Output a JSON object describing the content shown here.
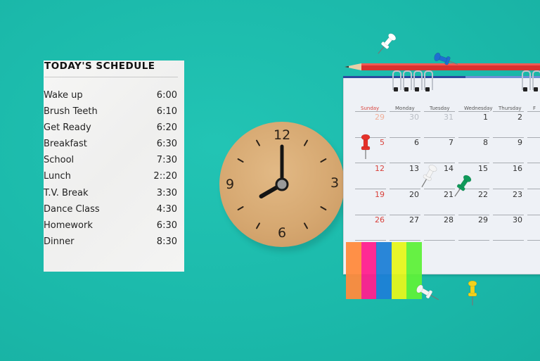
{
  "background_color": "#1dbdae",
  "schedule": {
    "title": "TODAY'S SCHEDULE",
    "items": [
      {
        "activity": "Wake up",
        "time": "6:00"
      },
      {
        "activity": "Brush Teeth",
        "time": "6:10"
      },
      {
        "activity": "Get Ready",
        "time": "6:20"
      },
      {
        "activity": "Breakfast",
        "time": "6:30"
      },
      {
        "activity": "School",
        "time": "7:30"
      },
      {
        "activity": "Lunch",
        "time": "2::20"
      },
      {
        "activity": "T.V. Break",
        "time": "3:30"
      },
      {
        "activity": "Dance Class",
        "time": "4:30"
      },
      {
        "activity": "Homework",
        "time": "6:30"
      },
      {
        "activity": "Dinner",
        "time": "8:30"
      }
    ]
  },
  "clock": {
    "numerals": {
      "twelve": "12",
      "three": "3",
      "six": "6",
      "nine": "9"
    },
    "time_shown": "8:00"
  },
  "calendar": {
    "day_names": [
      "Sunday",
      "Monday",
      "Tuesday",
      "Wednesday",
      "Thursday",
      "F"
    ],
    "weeks": [
      [
        "29",
        "30",
        "31",
        "1",
        "2"
      ],
      [
        "5",
        "6",
        "7",
        "8",
        "9"
      ],
      [
        "12",
        "13",
        "14",
        "15",
        "16"
      ],
      [
        "19",
        "20",
        "21",
        "22",
        "23"
      ],
      [
        "26",
        "27",
        "28",
        "29",
        "30"
      ]
    ],
    "sunday_color": "#d9423c"
  },
  "sticky_flags": [
    "#ff8a3d",
    "#ff1f8e",
    "#1e7fd6",
    "#e6f51c",
    "#5ef03a"
  ],
  "pins": [
    {
      "name": "white-pin-top",
      "color": "#ffffff"
    },
    {
      "name": "blue-pin-top",
      "color": "#1e6fd0"
    },
    {
      "name": "red-pin",
      "color": "#e5312a"
    },
    {
      "name": "white-pin-calendar",
      "color": "#f4f4f4"
    },
    {
      "name": "green-pin",
      "color": "#0f9a5a"
    },
    {
      "name": "white-pin-bottom",
      "color": "#f4f4f4"
    },
    {
      "name": "yellow-pin",
      "color": "#f2d21b"
    }
  ]
}
